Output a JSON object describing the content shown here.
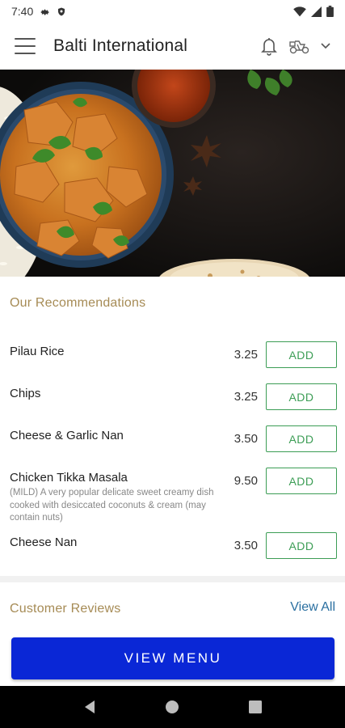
{
  "status_bar": {
    "time": "7:40"
  },
  "app_bar": {
    "title": "Balti International"
  },
  "recommendations": {
    "title": "Our Recommendations",
    "items": [
      {
        "name": "Pilau Rice",
        "description": "",
        "price": "3.25",
        "button": "ADD"
      },
      {
        "name": "Chips",
        "description": "",
        "price": "3.25",
        "button": "ADD"
      },
      {
        "name": "Cheese & Garlic Nan",
        "description": "",
        "price": "3.50",
        "button": "ADD"
      },
      {
        "name": "Chicken Tikka Masala",
        "description": "(MILD) A very popular delicate sweet creamy dish cooked with desiccated coconuts & cream (may contain nuts)",
        "price": "9.50",
        "button": "ADD"
      },
      {
        "name": "Cheese Nan",
        "description": "",
        "price": "3.50",
        "button": "ADD"
      }
    ]
  },
  "reviews": {
    "title": "Customer Reviews",
    "view_all": "View All"
  },
  "view_menu": {
    "label": "VIEW MENU"
  },
  "colors": {
    "accent_gold": "#a68b55",
    "add_green": "#3c9d55",
    "primary_blue": "#0a27d6",
    "link_blue": "#2a6fa0"
  }
}
